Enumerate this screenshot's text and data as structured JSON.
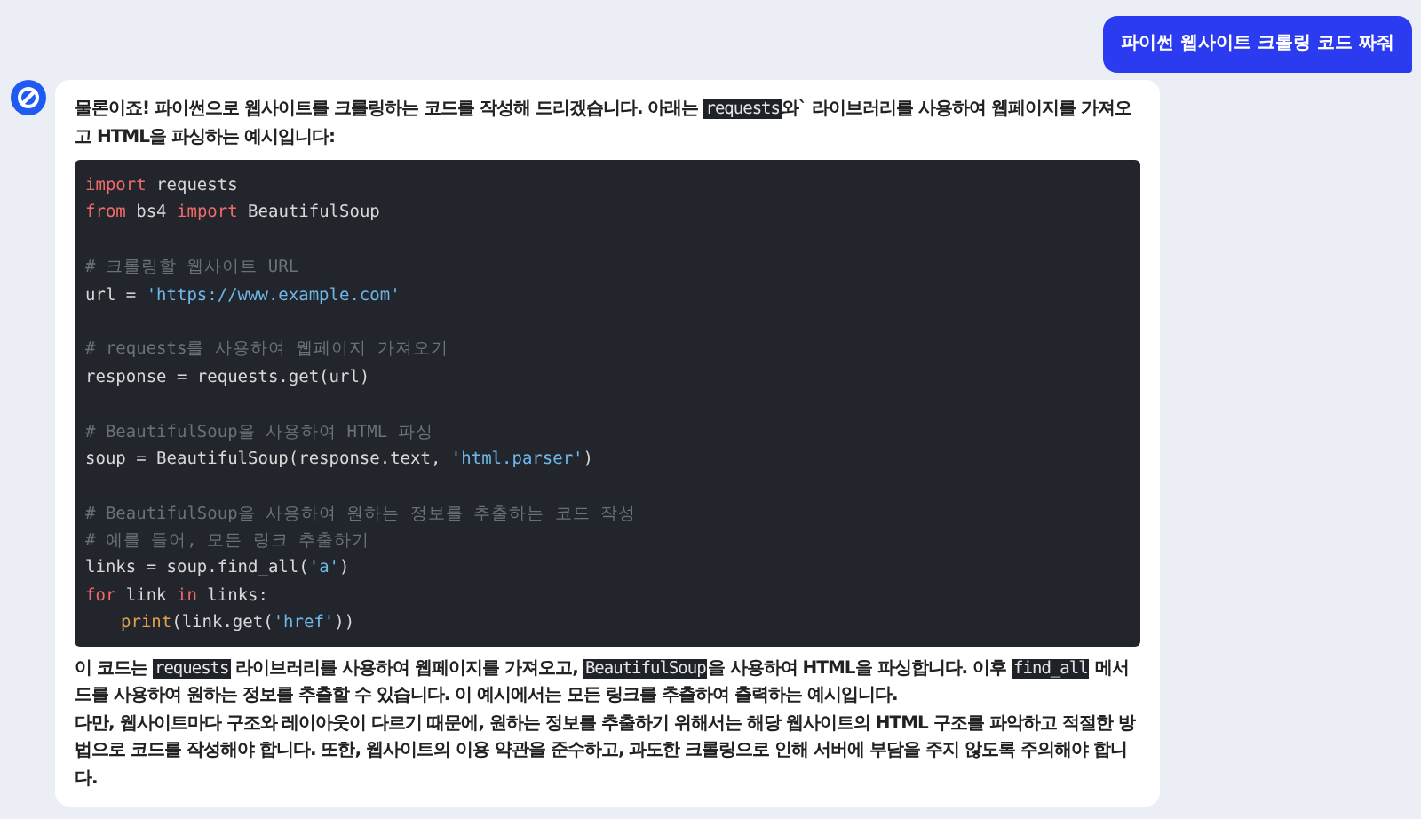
{
  "user_message": {
    "text": "파이썬 웹사이트 크롤링 코드 짜줘"
  },
  "assistant_message": {
    "intro": [
      {
        "kind": "text",
        "text": "물론이죠! 파이썬으로 웹사이트를 크롤링하는 코드를 작성해 드리겠습니다. 아래는 "
      },
      {
        "kind": "code",
        "text": "requests"
      },
      {
        "kind": "text",
        "text": "와` 라이브러리를 사용하여 웹페이지를 가져오고 HTML을 파싱하는 예시입니다:"
      }
    ],
    "code_lines": [
      {
        "kind": "code",
        "tokens": [
          {
            "kind": "keyword",
            "text": "import"
          },
          {
            "kind": "plain",
            "text": " requests"
          }
        ]
      },
      {
        "kind": "code",
        "tokens": [
          {
            "kind": "keyword",
            "text": "from"
          },
          {
            "kind": "plain",
            "text": " bs4 "
          },
          {
            "kind": "keyword",
            "text": "import"
          },
          {
            "kind": "plain",
            "text": " BeautifulSoup"
          }
        ]
      },
      {
        "kind": "blank"
      },
      {
        "kind": "code",
        "tokens": [
          {
            "kind": "comment",
            "text": "# 크롤링할 웹사이트 URL"
          }
        ]
      },
      {
        "kind": "code",
        "tokens": [
          {
            "kind": "plain",
            "text": "url = "
          },
          {
            "kind": "string",
            "text": "'https://www.example.com'"
          }
        ]
      },
      {
        "kind": "blank"
      },
      {
        "kind": "code",
        "tokens": [
          {
            "kind": "comment",
            "text": "# requests를 사용하여 웹페이지 가져오기"
          }
        ]
      },
      {
        "kind": "code",
        "tokens": [
          {
            "kind": "plain",
            "text": "response = requests.get(url)"
          }
        ]
      },
      {
        "kind": "blank"
      },
      {
        "kind": "code",
        "tokens": [
          {
            "kind": "comment",
            "text": "# BeautifulSoup을 사용하여 HTML 파싱"
          }
        ]
      },
      {
        "kind": "code",
        "tokens": [
          {
            "kind": "plain",
            "text": "soup = BeautifulSoup(response.text, "
          },
          {
            "kind": "string",
            "text": "'html.parser'"
          },
          {
            "kind": "plain",
            "text": ")"
          }
        ]
      },
      {
        "kind": "blank"
      },
      {
        "kind": "code",
        "tokens": [
          {
            "kind": "comment",
            "text": "# BeautifulSoup을 사용하여 원하는 정보를 추출하는 코드 작성"
          }
        ]
      },
      {
        "kind": "code",
        "tokens": [
          {
            "kind": "comment",
            "text": "# 예를 들어, 모든 링크 추출하기"
          }
        ]
      },
      {
        "kind": "code",
        "tokens": [
          {
            "kind": "plain",
            "text": "links = soup.find_all("
          },
          {
            "kind": "string",
            "text": "'a'"
          },
          {
            "kind": "plain",
            "text": ")"
          }
        ]
      },
      {
        "kind": "code",
        "tokens": [
          {
            "kind": "keyword",
            "text": "for"
          },
          {
            "kind": "plain",
            "text": " link "
          },
          {
            "kind": "keyword",
            "text": "in"
          },
          {
            "kind": "plain",
            "text": " links:"
          }
        ]
      },
      {
        "kind": "code",
        "indented": true,
        "tokens": [
          {
            "kind": "builtin",
            "text": "print"
          },
          {
            "kind": "plain",
            "text": "(link.get("
          },
          {
            "kind": "string",
            "text": "'href'"
          },
          {
            "kind": "plain",
            "text": "))"
          }
        ]
      }
    ],
    "outro": [
      [
        {
          "kind": "text",
          "text": "이 코드는 "
        },
        {
          "kind": "code",
          "text": "requests"
        },
        {
          "kind": "text",
          "text": " 라이브러리를 사용하여 웹페이지를 가져오고, "
        },
        {
          "kind": "code",
          "text": "BeautifulSoup"
        },
        {
          "kind": "text",
          "text": "을 사용하여 HTML을 파싱합니다. 이후 "
        },
        {
          "kind": "code",
          "text": "find_all"
        },
        {
          "kind": "text",
          "text": " 메서드를 사용하여 원하는 정보를 추출할 수 있습니다. 이 예시에서는 모든 링크를 추출하여 출력하는 예시입니다."
        }
      ],
      [
        {
          "kind": "text",
          "text": "다만, 웹사이트마다 구조와 레이아웃이 다르기 때문에, 원하는 정보를 추출하기 위해서는 해당 웹사이트의 HTML 구조를 파악하고 적절한 방법으로 코드를 작성해야 합니다. 또한, 웹사이트의 이용 약관을 준수하고, 과도한 크롤링으로 인해 서버에 부담을 주지 않도록 주의해야 합니다."
        }
      ]
    ]
  }
}
